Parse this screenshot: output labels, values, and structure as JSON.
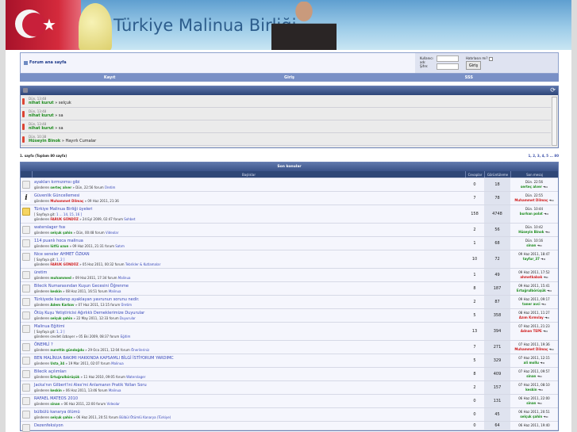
{
  "site": {
    "title": "Türkiye Malinua Birliği"
  },
  "top": {
    "home": "Forum ana sayfa",
    "user_label": "Kullanıcı adı:",
    "pass_label": "Şifre:",
    "remember": "Hatırlasın mı?",
    "login_btn": "Giriş"
  },
  "nav": [
    "Kayıt",
    "Giriş",
    "SSS"
  ],
  "shout": [
    {
      "time": "Dün, 13:48",
      "user": "nihat kurut",
      "text": "» selçuk"
    },
    {
      "time": "Dün, 13:48",
      "user": "nihat kurut",
      "text": "» sa"
    },
    {
      "time": "Dün, 13:48",
      "user": "nihat kurut",
      "text": "» sa"
    },
    {
      "time": "Dün, 10:38",
      "user": "Hüseyin Binok",
      "text": "» Hayırlı Cumalar"
    }
  ],
  "paging": {
    "left": "1. sayfa (Toplam 80 sayfa)",
    "right": "1, 2, 3, 4, 5 ... 80"
  },
  "topics": {
    "title": "Son konular",
    "headers": [
      "Başlıklar",
      "Cevaplar",
      "Görüntüleme",
      "Son mesaj"
    ],
    "by": "gönderen",
    "in": "forum",
    "goto": "[ Sayfaya git:",
    "rows": [
      {
        "icon": "normal",
        "title": "ayakları kırmızımsı gibi",
        "author": "serteç alver",
        "ac": "green",
        "date": "» Dün, 22:56",
        "forum": "Üretim",
        "replies": "0",
        "views": "18",
        "last_time": "Dün. 22:56",
        "last_user": "serteç alver",
        "lc": "green"
      },
      {
        "icon": "info",
        "title": "Güvenlik Güncellemesi",
        "author": "Muhammet Dilmaç",
        "ac": "red",
        "date": "» 09 Haz 2011, 21:36",
        "forum": "",
        "replies": "7",
        "views": "78",
        "last_time": "Dün. 22:55",
        "last_user": "Muhammet Dilmaç",
        "lc": "red"
      },
      {
        "icon": "hot",
        "title": "Türkiye Malinua Birliği üyeleri",
        "pages": "1 ... 14, 15, 16 ]",
        "author": "FARUK GÜNDÜZ",
        "ac": "red",
        "date": "» 24 Eyl 2009, 02:47",
        "forum": "Sohbet",
        "replies": "158",
        "views": "4748",
        "last_time": "Dün. 10:44",
        "last_user": "burhan polat",
        "lc": "green"
      },
      {
        "icon": "normal",
        "title": "waterslager fssı",
        "author": "selçuk şahin",
        "ac": "green",
        "date": "» Dün, 00:48",
        "forum": "Videolar",
        "replies": "2",
        "views": "56",
        "last_time": "Dün. 10:42",
        "last_user": "Hüseyin Binok",
        "lc": "green"
      },
      {
        "icon": "normal",
        "title": "114 puanlı hoca malinua",
        "author": "lütfü uzun",
        "ac": "green",
        "date": "» 09 Haz 2011, 21:31",
        "forum": "Satım",
        "replies": "1",
        "views": "68",
        "last_time": "Dün. 10:16",
        "last_user": "sinan",
        "lc": "green"
      },
      {
        "icon": "normal",
        "title": "Nice seneler AHMET ÖZKAN",
        "pages": "1, 2 ]",
        "author": "FARUK GÜNDÜZ",
        "ac": "red",
        "date": "» 05 Haz 2011, 00:32",
        "forum": "Tebrikler & Kutlamalar",
        "replies": "10",
        "views": "72",
        "last_time": "09 Haz 2011, 18:47",
        "last_user": "tayfur_37",
        "lc": "green"
      },
      {
        "icon": "normal",
        "title": "üretim",
        "author": "muhammed",
        "ac": "green",
        "date": "» 09 Haz 2011, 17:34",
        "forum": "Malinua",
        "replies": "1",
        "views": "49",
        "last_time": "09 Haz 2011, 17:52",
        "last_user": "ahmetkabak",
        "lc": "red"
      },
      {
        "icon": "normal",
        "title": "Bilecik Numarasından Kuşun Gecesini Öğrenme",
        "author": "keskin",
        "ac": "green",
        "date": "» 08 Haz 2011, 16:51",
        "forum": "Malinua",
        "replies": "8",
        "views": "187",
        "last_time": "09 Haz 2011, 15:41",
        "last_user": "Ertuğrulbörüşük",
        "lc": "green"
      },
      {
        "icon": "normal",
        "title": "Türkiyede kadanıp ayaklayan yavrunun sorunu nedir.",
        "author": "Adem Karbav",
        "ac": "green",
        "date": "» 07 Haz 2011, 13:15",
        "forum": "Üretim",
        "replies": "2",
        "views": "87",
        "last_time": "09 Haz 2011, 09:17",
        "last_user": "taner avci",
        "lc": "green"
      },
      {
        "icon": "normal",
        "title": "Ötüş Kuşu Yetiştiricisi Ağırlıklı Derneklerimize Duyurular",
        "author": "selçuk şahin",
        "ac": "green",
        "date": "» 22 May 2011, 12:33",
        "forum": "Duyurular",
        "replies": "5",
        "views": "358",
        "last_time": "08 Haz 2011, 11:27",
        "last_user": "Azım Kırmılay",
        "lc": "red"
      },
      {
        "icon": "normal",
        "title": "Malinua Eğitimi",
        "pages": "1, 2 ]",
        "author": "cevdet özbayer",
        "ac": "plain",
        "date": "» 05 Eki 2009, 08:37",
        "forum": "Eğitim",
        "replies": "13",
        "views": "394",
        "last_time": "07 Haz 2011, 21:23",
        "last_user": "Adnan TEPE",
        "lc": "red"
      },
      {
        "icon": "normal",
        "title": "ÖNEMLİ ?",
        "author": "nurettin gündoğdu",
        "ac": "green",
        "date": "» 29 Oca 2011, 12:04",
        "forum": "Önerileriniz",
        "replies": "7",
        "views": "271",
        "last_time": "07 Haz 2011, 19:36",
        "last_user": "Muhammet Dilmaç",
        "lc": "red"
      },
      {
        "icon": "normal",
        "title": "BEN MALİNUA BAKIMI HAKKINDA KAPSAMLI BİLGİ İSTİYORUM YARDIMC",
        "author": "Usta_34",
        "ac": "green",
        "date": "» 19 Mar 2011, 02:07",
        "forum": "Malinua",
        "replies": "5",
        "views": "329",
        "last_time": "07 Haz 2011, 12:15",
        "last_user": "ali mollu",
        "lc": "green"
      },
      {
        "icon": "normal",
        "title": "Bilecik açılımları",
        "author": "Ertuğrulbörüşük",
        "ac": "green",
        "date": "» 11 Haz 2010, 09:05",
        "forum": "Waterslager",
        "replies": "8",
        "views": "409",
        "last_time": "07 Haz 2011, 09:57",
        "last_user": "sinan",
        "lc": "green"
      },
      {
        "icon": "normal",
        "title": "Jacka'nın Gilbert'ini Alex'mi Anlamanın Pratik Yolları Soru",
        "author": "keskin",
        "ac": "green",
        "date": "» 06 Haz 2011, 13:46",
        "forum": "Malinua",
        "replies": "2",
        "views": "157",
        "last_time": "07 Haz 2011, 08:10",
        "last_user": "keskin",
        "lc": "green"
      },
      {
        "icon": "normal",
        "title": "RAFAEL MATEOS 2010",
        "author": "sinan",
        "ac": "green",
        "date": "» 06 Haz 2011, 22:00",
        "forum": "Videolar",
        "replies": "0",
        "views": "131",
        "last_time": "06 Haz 2011, 22:00",
        "last_user": "sinan",
        "lc": "green"
      },
      {
        "icon": "normal",
        "title": "bülbülü kanarya ölümü",
        "author": "selçuk şahin",
        "ac": "green",
        "date": "» 06 Haz 2011, 20:51",
        "forum": "Bülbül Ötümlü Kanarya (Türkiye)",
        "replies": "0",
        "views": "45",
        "last_time": "06 Haz 2011, 20:51",
        "last_user": "selçuk şahin",
        "lc": "green"
      },
      {
        "icon": "normal",
        "title": "Dezenfeksiyon",
        "replies": "0",
        "views": "64",
        "last_time": "06 Haz 2011, 19:40"
      }
    ]
  }
}
